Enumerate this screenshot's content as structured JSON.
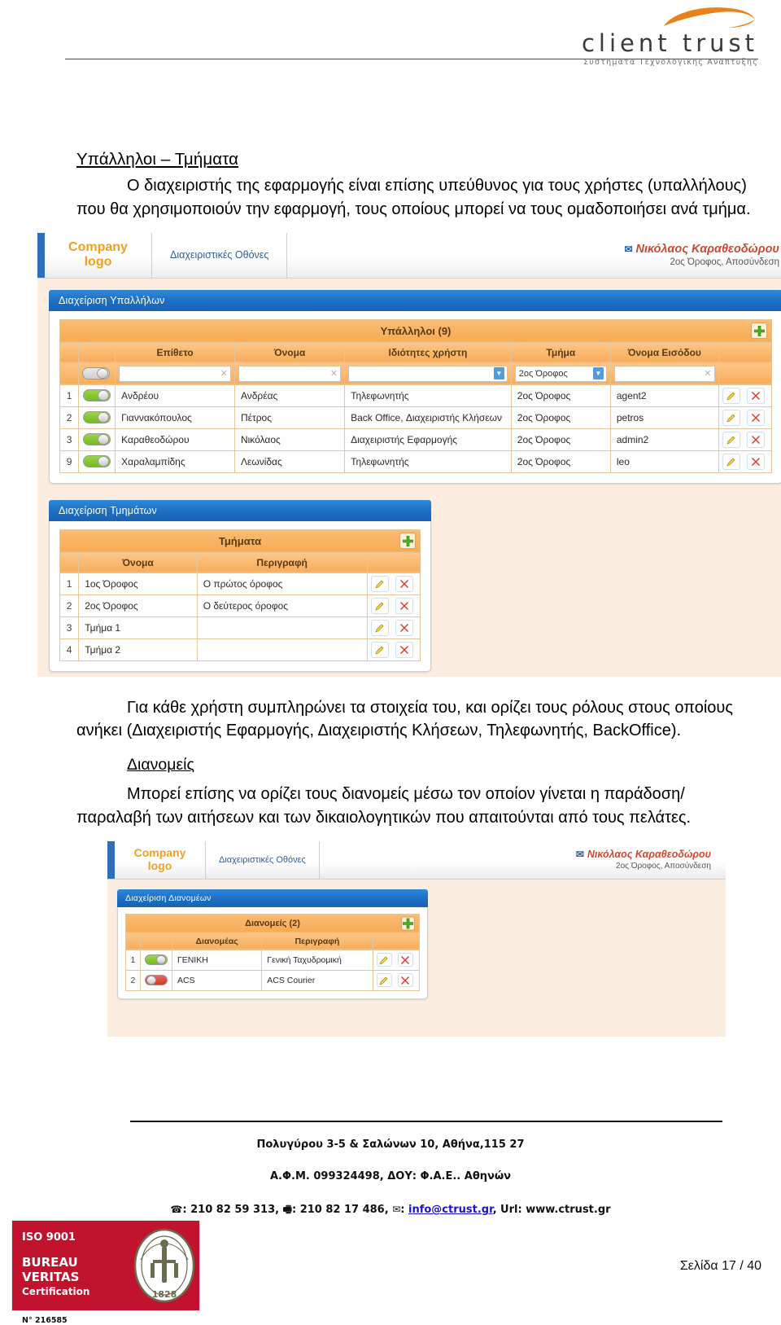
{
  "brand": {
    "name": "client trust",
    "tagline": "Συστηματα Τεχνολογικης Αναπτυξης",
    "swoosh_color": "#e8811a"
  },
  "document": {
    "section_title": "Υπάλληλοι – Τμήματα",
    "paragraph_1": "Ο διαχειριστής της εφαρμογής είναι επίσης υπεύθυνος για τους χρήστες (υπαλλήλους) που θα χρησιμοποιούν την εφαρμογή, τους οποίους μπορεί να τους ομαδοποιήσει ανά τμήμα.",
    "paragraph_2": "Για κάθε χρήστη συμπληρώνει τα στοιχεία του, και ορίζει τους ρόλους στους οποίους ανήκει (Διαχειριστής Εφαρμογής, Διαχειριστής Κλήσεων, Τηλεφωνητής, BackOffice).",
    "sub_title": "Διανομείς",
    "paragraph_3": "Μπορεί επίσης να ορίζει τους διανομείς μέσω τον οποίον γίνεται η παράδοση/παραλαβή των αιτήσεων και των δικαιολογητικών που απαιτούνται από τους πελάτες."
  },
  "screenshot_1": {
    "topbar": {
      "logo_line_1": "Company",
      "logo_line_2": "logo",
      "nav_label": "Διαχειριστικές Οθόνες",
      "user_name": "Νικόλαος Καραθεοδώρου",
      "user_sub": "2ος Όροφος, Αποσύνδεση"
    },
    "panel_employees": {
      "panel_title": "Διαχείριση Υπαλλήλων",
      "grid_caption": "Υπάλληλοι (9)",
      "add_label": "add-row",
      "columns": [
        "",
        "",
        "Επίθετο",
        "Όνομα",
        "Ιδιότητες χρήστη",
        "Τμήμα",
        "Όνομα Εισόδου",
        ""
      ],
      "filters": {
        "epitheto": "",
        "onoma": "",
        "idiotites": "",
        "tmima": "2ος Όροφος",
        "onoma_eisodou": ""
      },
      "rows": [
        {
          "num": "1",
          "active": "on",
          "epitheto": "Ανδρέου",
          "onoma": "Ανδρέας",
          "idiotites": "Τηλεφωνητής",
          "tmima": "2ος Όροφος",
          "login": "agent2"
        },
        {
          "num": "2",
          "active": "on",
          "epitheto": "Γιαννακόπουλος",
          "onoma": "Πέτρος",
          "idiotites": "Back Office, Διαχειριστής Κλήσεων",
          "tmima": "2ος Όροφος",
          "login": "petros"
        },
        {
          "num": "3",
          "active": "on",
          "epitheto": "Καραθεοδώρου",
          "onoma": "Νικόλαος",
          "idiotites": "Διαχειριστής Εφαρμογής",
          "tmima": "2ος Όροφος",
          "login": "admin2"
        },
        {
          "num": "9",
          "active": "on",
          "epitheto": "Χαραλαμπίδης",
          "onoma": "Λεωνίδας",
          "idiotites": "Τηλεφωνητής",
          "tmima": "2ος Όροφος",
          "login": "leo"
        }
      ]
    },
    "panel_departments": {
      "panel_title": "Διαχείριση Τμημάτων",
      "grid_caption": "Τμήματα",
      "columns": [
        "",
        "Όνομα",
        "Περιγραφή",
        ""
      ],
      "rows": [
        {
          "num": "1",
          "onoma": "1ος Όροφος",
          "perigrafi": "Ο πρώτος όροφος"
        },
        {
          "num": "2",
          "onoma": "2ος Όροφος",
          "perigrafi": "Ο δεύτερος όροφος"
        },
        {
          "num": "3",
          "onoma": "Τμήμα 1",
          "perigrafi": ""
        },
        {
          "num": "4",
          "onoma": "Τμήμα 2",
          "perigrafi": ""
        }
      ]
    }
  },
  "screenshot_2": {
    "topbar": {
      "logo_line_1": "Company",
      "logo_line_2": "logo",
      "nav_label": "Διαχειριστικές Οθόνες",
      "user_name": "Νικόλαος Καραθεοδώρου",
      "user_sub": "2ος Όροφος, Αποσύνδεση"
    },
    "panel_couriers": {
      "panel_title": "Διαχείριση Διανομέων",
      "grid_caption": "Διανομείς (2)",
      "columns": [
        "",
        "",
        "Διανομέας",
        "Περιγραφή",
        ""
      ],
      "rows": [
        {
          "num": "1",
          "active": "on",
          "dianomeas": "ΓΕΝΙΚΗ",
          "perigrafi": "Γενική Ταχυδρομική"
        },
        {
          "num": "2",
          "active": "off",
          "dianomeas": "ACS",
          "perigrafi": "ACS Courier"
        }
      ]
    }
  },
  "footer": {
    "address": "Πολυγύρου 3-5 & Σαλώνων 10, Αθήνα,115 27",
    "tax": "Α.Φ.Μ. 099324498, ΔΟΥ: Φ.Α.Ε.. Αθηνών",
    "phone_label": "☎",
    "phone": "210 82 59 313,",
    "fax_label": "🖷",
    "fax": "210 82 17 486,",
    "mail_label": "✉",
    "email": "info@ctrust.gr",
    "url_label": ", Url:",
    "url": "www.ctrust.gr",
    "page_number": "Σελίδα 17 / 40",
    "iso": {
      "line1": "ISO 9001",
      "line2": "BUREAU VERITAS",
      "line3": "Certification",
      "number": "N° 216585",
      "seal_top": "BUREAU VERITAS",
      "seal_year": "1828"
    }
  }
}
